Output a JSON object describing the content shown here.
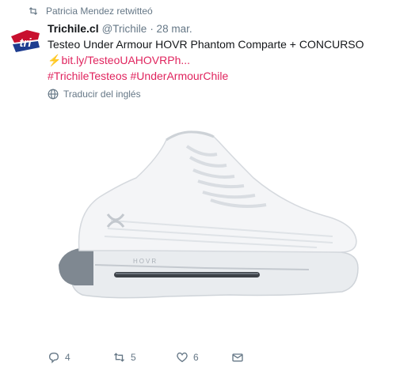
{
  "retweet": {
    "text": "Patricia Mendez retwitteó"
  },
  "tweet": {
    "name": "Trichile.cl",
    "handle": "@Trichile",
    "date": "· 28 mar.",
    "text": "Testeo Under Armour HOVR Phantom Comparte + CONCURSO",
    "link": "bit.ly/TesteoUAHOVRPh...",
    "hashtags": "#TrichileTesteos #UnderArmourChile",
    "translate": "Traducir del inglés"
  },
  "media": {
    "brand_text": "HOVR"
  },
  "actions": {
    "replies": "4",
    "retweets": "5",
    "likes": "6"
  },
  "colors": {
    "accent": "#e0245e",
    "muted": "#657786",
    "text": "#14171a"
  }
}
